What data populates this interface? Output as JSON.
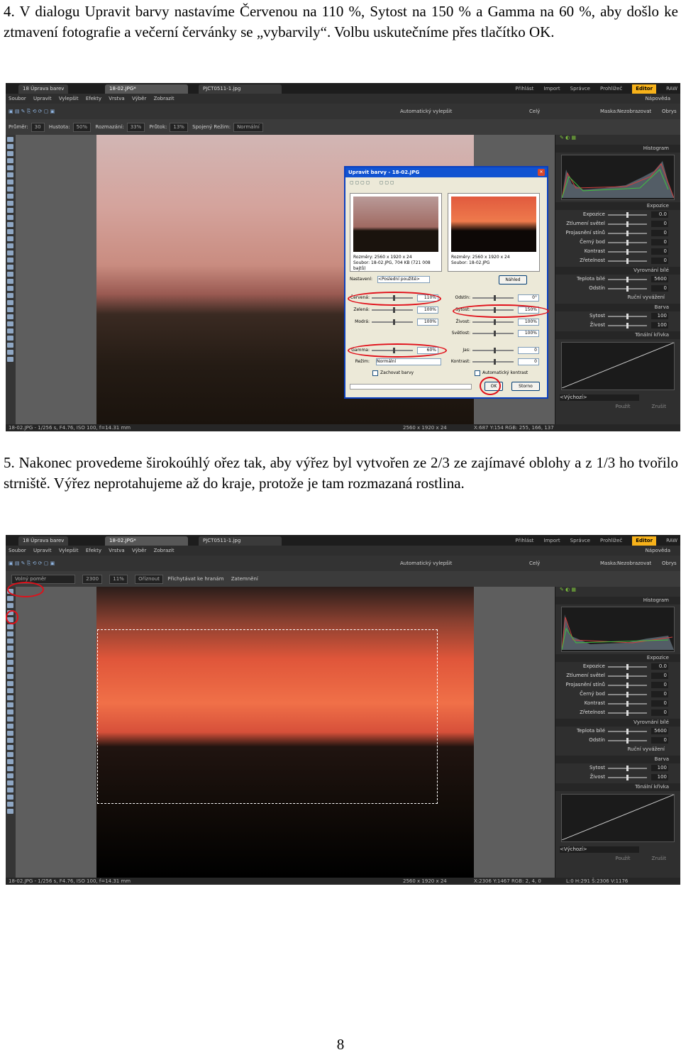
{
  "step4": {
    "text": "4. V dialogu Upravit barvy nastavíme Červenou na 110 %, Sytost na 150 % a Gamma na 60 %, aby došlo ke ztmavení fotografie a večerní červánky se „vybarvily“. Volbu uskutečníme přes tlačítko OK."
  },
  "step5": {
    "text": "5. Nakonec provedeme širokoúhlý ořez tak, aby výřez byl vytvořen ze  2/3 ze zajímavé oblohy a z 1/3 ho tvořilo strniště. Výřez neprotahujeme až do kraje, protože je tam rozmazaná rostlina."
  },
  "page_number": "8",
  "app": {
    "tabs": [
      "18 Úprava barev",
      "18-02.JPG*",
      "PJCT0511-1.jpg"
    ],
    "modes": [
      "Přihlást",
      "Import",
      "Správce",
      "Prohlížeč",
      "Editor",
      "RAW"
    ],
    "menu": [
      "Soubor",
      "Upravit",
      "Vylepšit",
      "Efekty",
      "Vrstva",
      "Výběr",
      "Zobrazit"
    ],
    "toolbar_right": "Automatický vylepšit",
    "zoom": "Celý",
    "mask_label": "Maska:",
    "mask_value": "Nezobrazovat",
    "obrys": "Obrys",
    "help": "Nápověda",
    "panel": {
      "histogram": "Histogram",
      "expozice": "Expozice",
      "rows1": [
        {
          "label": "Expozice",
          "value": "0.0"
        },
        {
          "label": "Ztlumení světel",
          "value": "0"
        },
        {
          "label": "Projasnění stínů",
          "value": "0"
        },
        {
          "label": "Černý bod",
          "value": "0"
        },
        {
          "label": "Kontrast",
          "value": "0"
        },
        {
          "label": "Zřetelnost",
          "value": "0"
        }
      ],
      "vyrovnani": "Vyrovnání bílé",
      "rows2": [
        {
          "label": "Teplota bílé",
          "value": "5600"
        },
        {
          "label": "Odstín",
          "value": "0"
        }
      ],
      "rucni": "Ruční vyvážení",
      "barva": "Barva",
      "rows3": [
        {
          "label": "Sytost",
          "value": "100"
        },
        {
          "label": "Živost",
          "value": "100"
        }
      ],
      "tonalni": "Tónální křivka",
      "vychozi": "<Výchozí>",
      "pouzit": "Použít",
      "zrusit": "Zrušit"
    }
  },
  "shot1": {
    "opt": [
      "Průměr:",
      "30",
      "Hustota:",
      "50%",
      "Rozmazání:",
      "33%",
      "Průtok:",
      "13%",
      "Spojený",
      "Režim:",
      "Normální"
    ],
    "status_left": "18-02.JPG - 1/256 s, F4.76, ISO 100, f=14.31 mm",
    "status_mid": "2560 x 1920 x 24",
    "status_right": "X:687 Y:154  RGB: 255, 166, 137",
    "dialog": {
      "title": "Upravit barvy - 18-02.JPG",
      "info_left": [
        "Rozměry: 2560 x 1920 x 24",
        "Soubor: 18-02.JPG, 704 KB (721 008 bajtů)"
      ],
      "info_right": [
        "Rozměry: 2560 x 1920 x 24",
        "Soubor: 18-02.JPG"
      ],
      "nastaveni_label": "Nastavení:",
      "nastaveni_value": "<Poslední použité>",
      "nahled": "Náhled",
      "left_rows": [
        {
          "label": "Červená:",
          "value": "110%"
        },
        {
          "label": "Zelená:",
          "value": "100%"
        },
        {
          "label": "Modrá:",
          "value": "100%"
        }
      ],
      "right_rows": [
        {
          "label": "Odstín:",
          "value": "0°"
        },
        {
          "label": "Sytost:",
          "value": "150%"
        },
        {
          "label": "Živost:",
          "value": "100%"
        },
        {
          "label": "Světlost:",
          "value": "100%"
        }
      ],
      "gamma_label": "Gamma:",
      "gamma_value": "60%",
      "rezim_label": "Režim:",
      "rezim_value": "Normální",
      "jas_label": "Jas:",
      "jas_value": "0",
      "kontrast_label": "Kontrast:",
      "kontrast_value": "0",
      "zachovat": "Zachovat barvy",
      "auto_kontrast": "Automatický kontrast",
      "ok": "OK",
      "storno": "Storno"
    }
  },
  "shot2": {
    "opt": [
      "Volný poměr",
      "2300",
      "11%",
      "Oříznout",
      "Přichytávat ke hranám",
      "Zatemnění"
    ],
    "status_left": "18-02.JPG - 1/256 s, F4.76, ISO 100, f=14.31 mm",
    "status_mid": "2560 x 1920 x 24",
    "status_right": "X:2306 Y:1467  RGB: 2, 4, 0",
    "status_far": "L:0  H:291  Š:2306  V:1176"
  },
  "colors": {
    "mark_red": "#e0101a",
    "editor_tab": "#f7b21a",
    "dialog_title": "#1153d1"
  }
}
